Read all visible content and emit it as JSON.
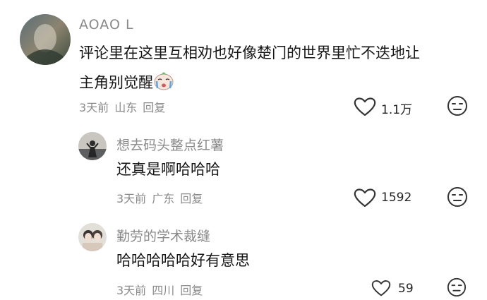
{
  "comments": [
    {
      "author": "AOAO L",
      "text_line1": "评论里在这里互相劝也好像楚门的世界里忙不迭地让",
      "text_line2": "主角别觉醒",
      "emoji": "crying-emoji",
      "time": "3天前",
      "location": "山东",
      "reply_label": "回复",
      "likes": "1.1万"
    },
    {
      "author": "想去码头整点红薯",
      "text": "还真是啊哈哈哈",
      "time": "3天前",
      "location": "广东",
      "reply_label": "回复",
      "likes": "1592"
    },
    {
      "author": "勤劳的学术裁缝",
      "text": "哈哈哈哈哈好有意思",
      "time": "3天前",
      "location": "四川",
      "reply_label": "回复",
      "likes": "59"
    }
  ],
  "icons": {
    "like": "heart-outline-icon",
    "dislike": "unhappy-face-icon"
  }
}
